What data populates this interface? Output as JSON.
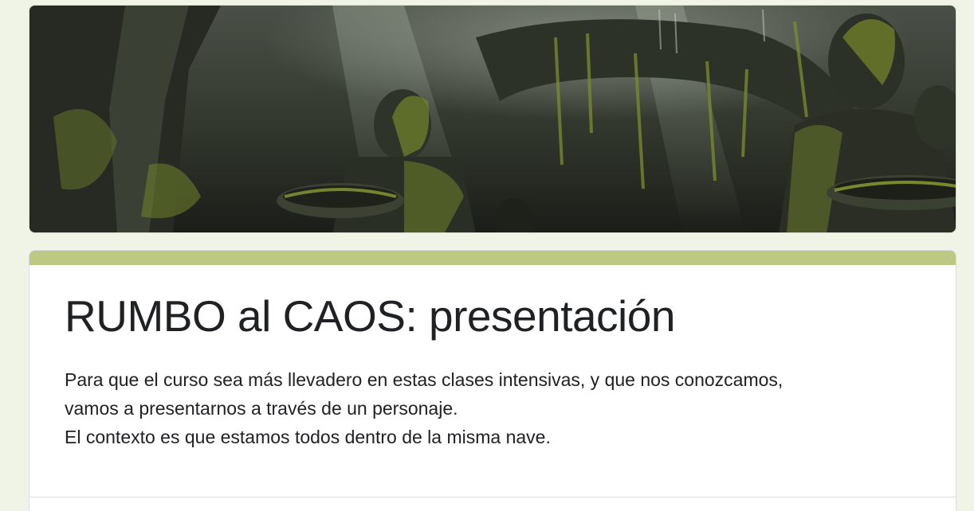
{
  "colors": {
    "page_background": "#f0f4e6",
    "accent": "#bdc882",
    "text": "#202124"
  },
  "header": {
    "image": "jungle-ruins-statues-banner"
  },
  "form": {
    "title": "RUMBO al CAOS: presentación",
    "description_lines": [
      "Para que el curso sea más llevadero en estas clases intensivas, y que nos conozcamos,",
      "vamos a presentarnos a través de un personaje.",
      "El contexto es que estamos todos dentro de la misma nave."
    ]
  }
}
